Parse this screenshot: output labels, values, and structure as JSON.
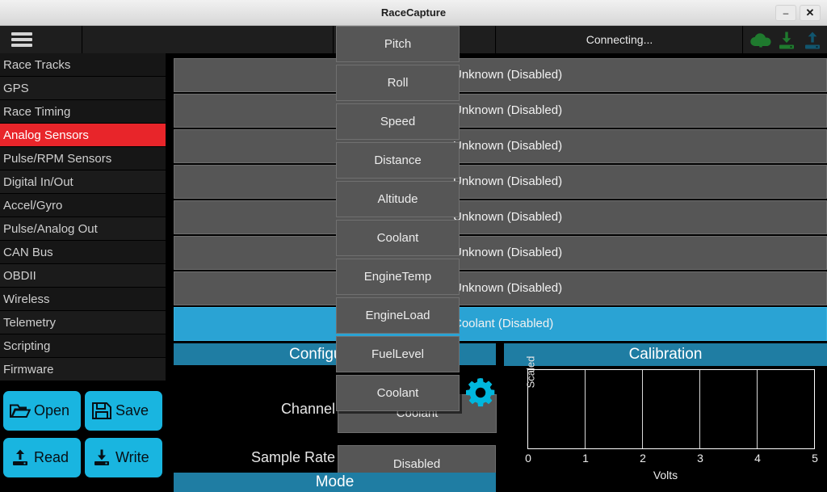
{
  "window": {
    "title": "RaceCapture",
    "minimize_label": "–",
    "close_label": "✕"
  },
  "toolbar": {
    "menu_icon": "hamburger-icon",
    "status_text": "Connecting...",
    "icons": [
      {
        "name": "cloud-upload-icon",
        "color": "#1f7a2e"
      },
      {
        "name": "download-to-device-icon",
        "color": "#1f7a2e"
      },
      {
        "name": "upload-from-device-icon",
        "color": "#11556e"
      }
    ]
  },
  "sidebar": {
    "items": [
      {
        "label": "Race Tracks",
        "active": false
      },
      {
        "label": "GPS",
        "active": false
      },
      {
        "label": "Race Timing",
        "active": false
      },
      {
        "label": "Analog Sensors",
        "active": true
      },
      {
        "label": "Pulse/RPM Sensors",
        "active": false
      },
      {
        "label": "Digital In/Out",
        "active": false
      },
      {
        "label": "Accel/Gyro",
        "active": false
      },
      {
        "label": "Pulse/Analog Out",
        "active": false
      },
      {
        "label": "CAN Bus",
        "active": false
      },
      {
        "label": "OBDII",
        "active": false
      },
      {
        "label": "Wireless",
        "active": false
      },
      {
        "label": "Telemetry",
        "active": false
      },
      {
        "label": "Scripting",
        "active": false
      },
      {
        "label": "Firmware",
        "active": false
      }
    ],
    "active_color": "#e8252a",
    "buttons": [
      {
        "label": "Open",
        "icon": "open-folder-icon"
      },
      {
        "label": "Save",
        "icon": "floppy-disk-icon"
      },
      {
        "label": "Read",
        "icon": "read-from-device-icon"
      },
      {
        "label": "Write",
        "icon": "write-to-device-icon"
      }
    ],
    "button_color": "#19b5e0"
  },
  "channels": {
    "rows": [
      {
        "text": "Unknown (Disabled)",
        "selected": false
      },
      {
        "text": "Unknown (Disabled)",
        "selected": false
      },
      {
        "text": "Unknown (Disabled)",
        "selected": false
      },
      {
        "text": "Unknown (Disabled)",
        "selected": false
      },
      {
        "text": "Unknown (Disabled)",
        "selected": false
      },
      {
        "text": "Unknown (Disabled)",
        "selected": false
      },
      {
        "text": "Unknown (Disabled)",
        "selected": false
      },
      {
        "text": "Coolant (Disabled)",
        "selected": true
      }
    ],
    "selected_color": "#2aa3d4"
  },
  "configuration": {
    "header": "Configuration",
    "channel_label": "Channel",
    "channel_value": "Coolant",
    "sample_rate_label": "Sample Rate",
    "sample_rate_value": "Disabled",
    "gear_icon": "gear-icon",
    "gear_color": "#00b7dd",
    "mode_header": "Mode"
  },
  "calibration": {
    "header": "Calibration",
    "ylabel": "Scaled",
    "xlabel": "Volts",
    "xticks": [
      "0",
      "1",
      "2",
      "3",
      "4",
      "5"
    ]
  },
  "dropdown": {
    "items": [
      "Pitch",
      "Roll",
      "Speed",
      "Distance",
      "Altitude",
      "Coolant",
      "EngineTemp",
      "EngineLoad",
      "FuelLevel",
      "Coolant"
    ]
  },
  "chart_data": {
    "type": "line",
    "title": "Calibration",
    "xlabel": "Volts",
    "ylabel": "Scaled",
    "x": [],
    "values": [],
    "xlim": [
      0,
      5
    ],
    "xticks": [
      0,
      1,
      2,
      3,
      4,
      5
    ],
    "yticks": [],
    "grid": true,
    "legend": "none"
  }
}
